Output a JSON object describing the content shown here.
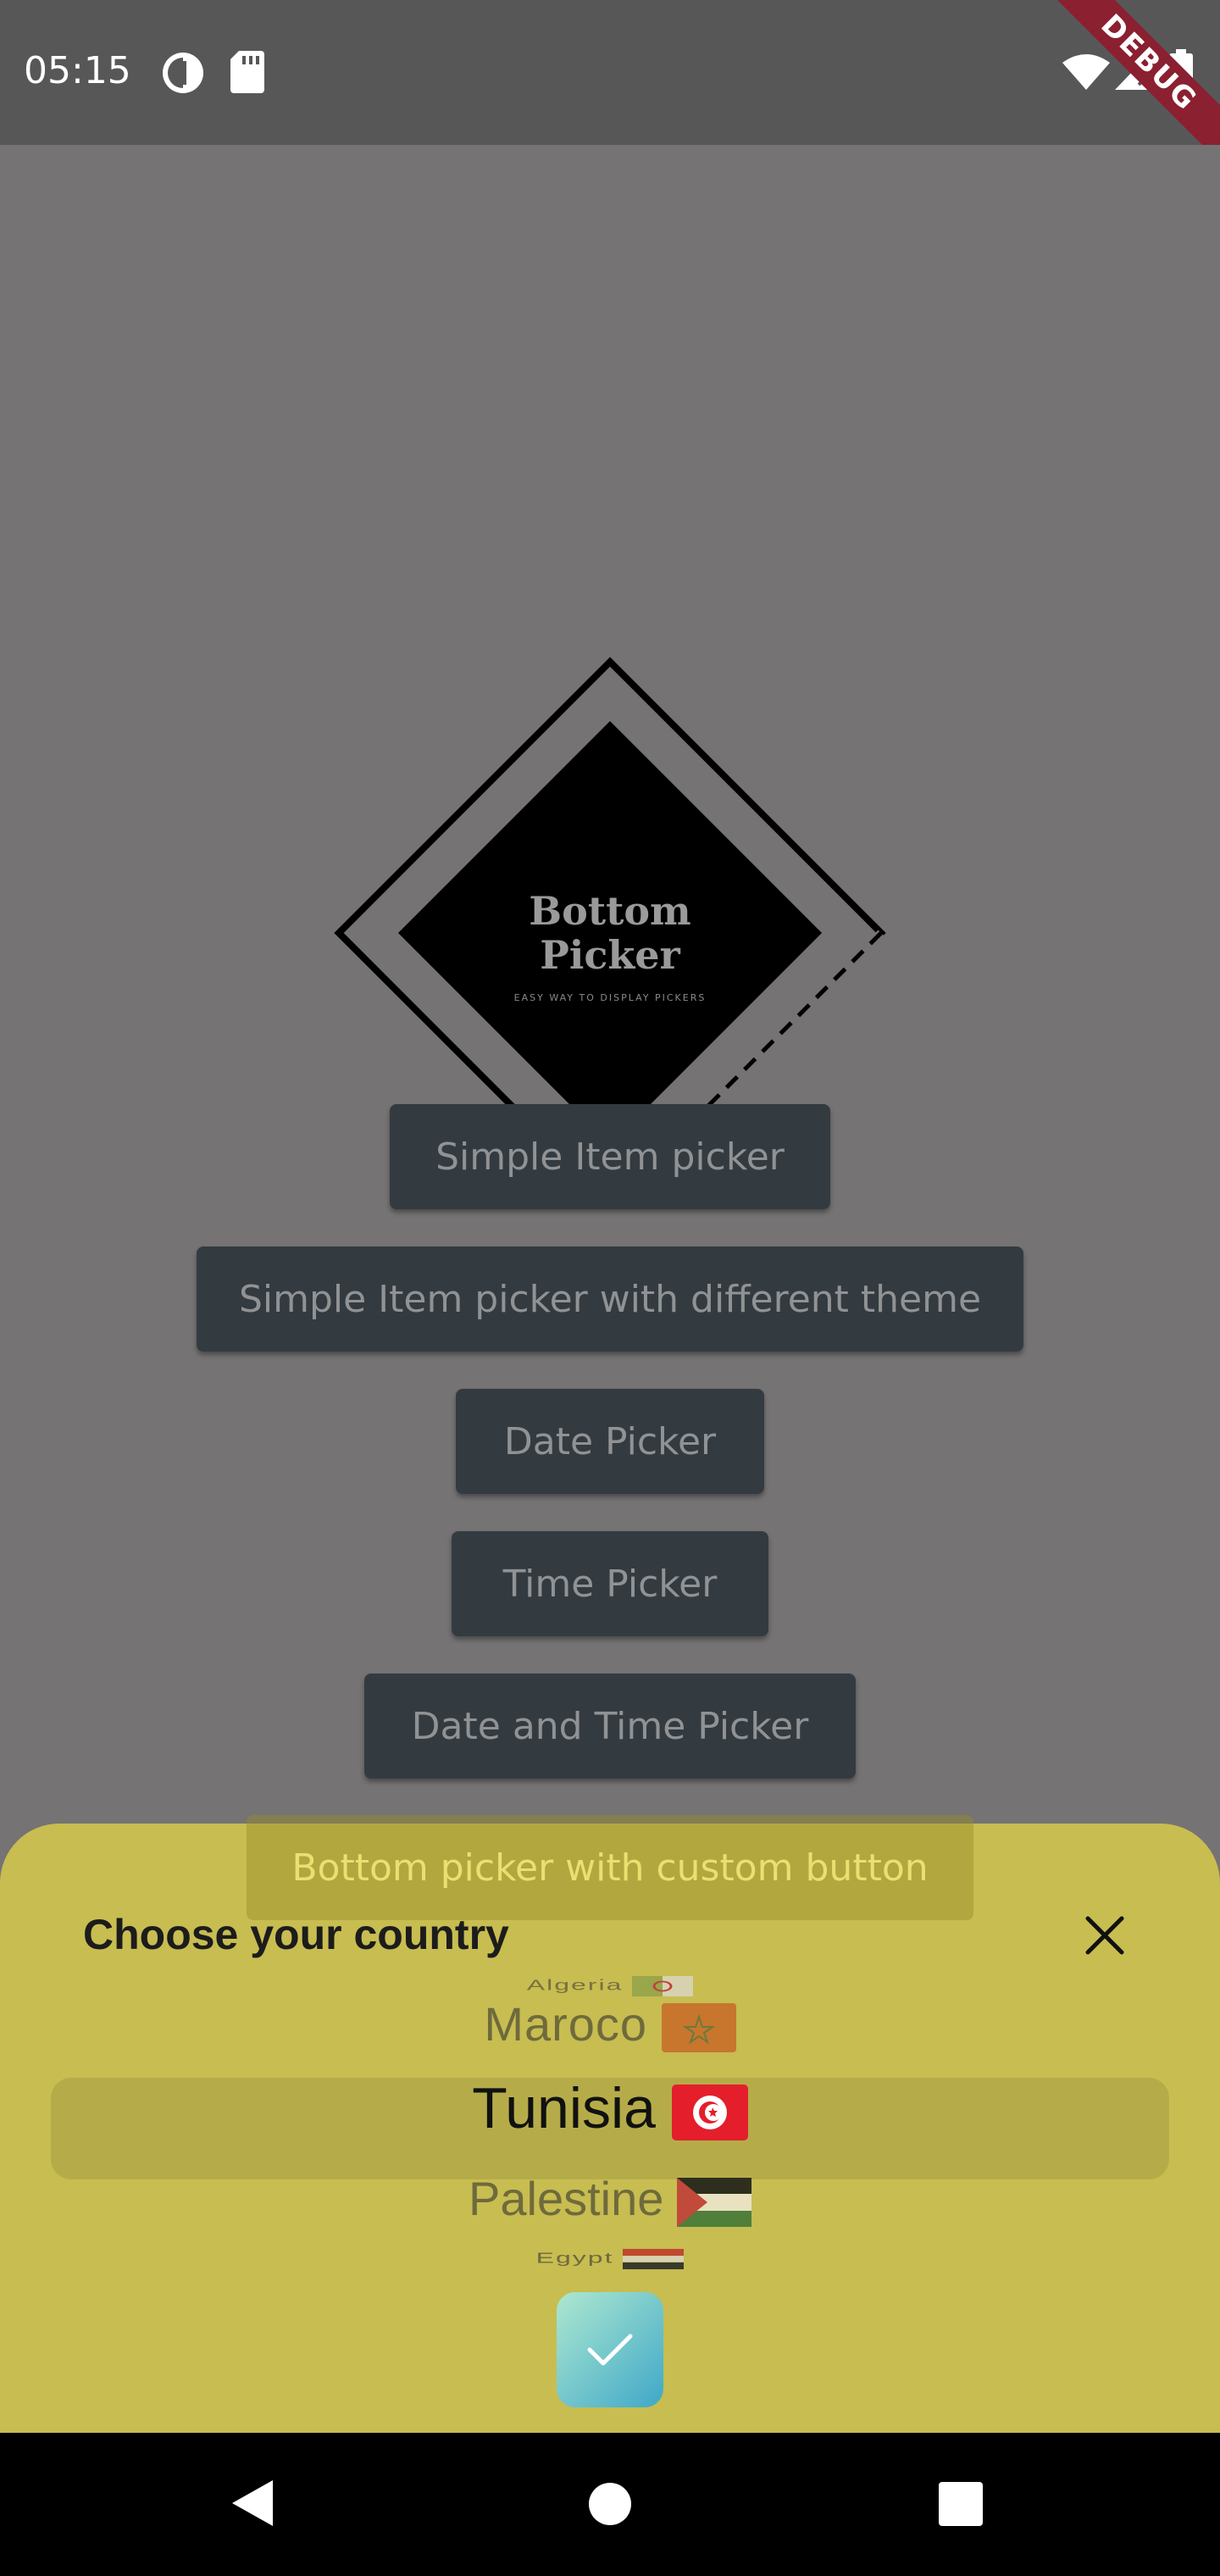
{
  "status_bar": {
    "time": "05:15",
    "left_icons": [
      "data-saver-icon",
      "sd-card-icon"
    ],
    "right_icons": [
      "wifi-icon",
      "signal-icon",
      "battery-icon"
    ],
    "debug_banner": "DEBUG"
  },
  "logo": {
    "title_line1": "Bottom",
    "title_line2": "Picker",
    "tagline": "EASY WAY TO DISPLAY PICKERS"
  },
  "buttons": {
    "simple_item_picker": "Simple Item picker",
    "simple_item_picker_theme": "Simple Item picker with different theme",
    "date_picker": "Date Picker",
    "time_picker": "Time Picker",
    "date_time_picker": "Date and Time Picker",
    "custom_button_picker": "Bottom picker with custom button"
  },
  "sheet": {
    "title": "Choose your country",
    "items": [
      {
        "label": "Algeria",
        "flag": "algeria-flag-icon"
      },
      {
        "label": "Maroco",
        "flag": "morocco-flag-icon"
      },
      {
        "label": "Tunisia",
        "flag": "tunisia-flag-icon"
      },
      {
        "label": "Palestine",
        "flag": "palestine-flag-icon"
      },
      {
        "label": "Egypt",
        "flag": "egypt-flag-icon"
      }
    ],
    "selected_index": 2,
    "close_icon": "close-icon",
    "confirm_icon": "check-icon"
  },
  "colors": {
    "sheet_background": "#c7bd51",
    "button_background": "#333b41",
    "overlay": "#757373",
    "confirm_gradient_start": "#aee8d0",
    "confirm_gradient_end": "#3fa8c8"
  },
  "nav_bar": {
    "icons": [
      "back-icon",
      "home-icon",
      "recents-icon"
    ]
  }
}
